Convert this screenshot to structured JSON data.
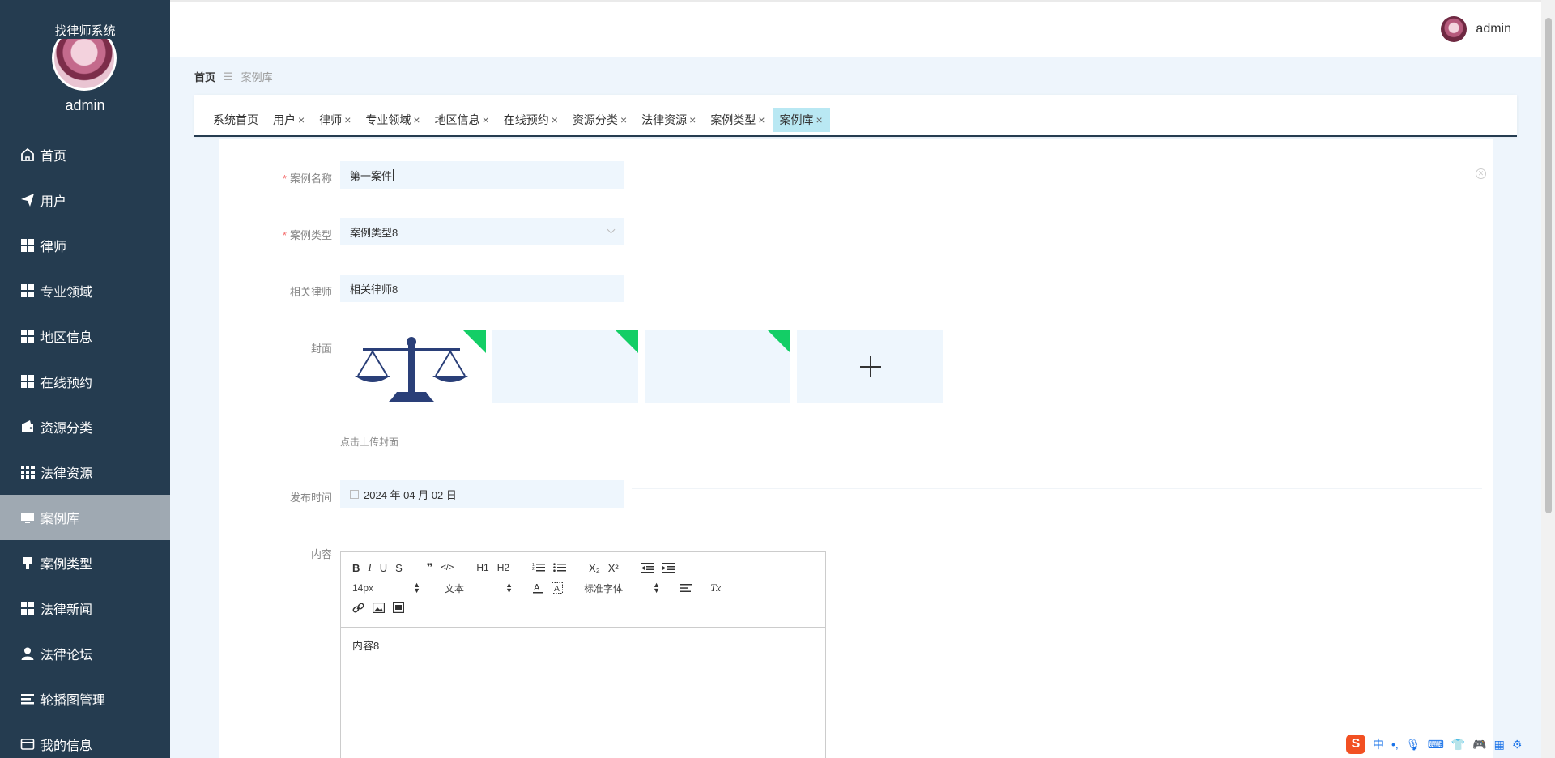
{
  "sidebar": {
    "system_title": "找律师系统",
    "username": "admin",
    "items": [
      {
        "label": "首页",
        "icon": "home-icon",
        "active": false
      },
      {
        "label": "用户",
        "icon": "paper-plane-icon",
        "active": false
      },
      {
        "label": "律师",
        "icon": "grid-icon",
        "active": false
      },
      {
        "label": "专业领域",
        "icon": "grid-icon",
        "active": false
      },
      {
        "label": "地区信息",
        "icon": "grid-icon",
        "active": false
      },
      {
        "label": "在线预约",
        "icon": "grid-icon",
        "active": false
      },
      {
        "label": "资源分类",
        "icon": "wallet-icon",
        "active": false
      },
      {
        "label": "法律资源",
        "icon": "grid9-icon",
        "active": false
      },
      {
        "label": "案例库",
        "icon": "monitor-icon",
        "active": true
      },
      {
        "label": "案例类型",
        "icon": "brush-icon",
        "active": false
      },
      {
        "label": "法律新闻",
        "icon": "grid-icon",
        "active": false
      },
      {
        "label": "法律论坛",
        "icon": "user-icon",
        "active": false
      },
      {
        "label": "轮播图管理",
        "icon": "list-icon",
        "active": false
      },
      {
        "label": "我的信息",
        "icon": "card-icon",
        "active": false
      }
    ]
  },
  "header": {
    "username": "admin"
  },
  "breadcrumb": {
    "home": "首页",
    "separator": "☰",
    "current": "案例库"
  },
  "tabs": [
    {
      "label": "系统首页",
      "closable": false,
      "active": false
    },
    {
      "label": "用户",
      "closable": true,
      "active": false
    },
    {
      "label": "律师",
      "closable": true,
      "active": false
    },
    {
      "label": "专业领域",
      "closable": true,
      "active": false
    },
    {
      "label": "地区信息",
      "closable": true,
      "active": false
    },
    {
      "label": "在线预约",
      "closable": true,
      "active": false
    },
    {
      "label": "资源分类",
      "closable": true,
      "active": false
    },
    {
      "label": "法律资源",
      "closable": true,
      "active": false
    },
    {
      "label": "案例类型",
      "closable": true,
      "active": false
    },
    {
      "label": "案例库",
      "closable": true,
      "active": true
    }
  ],
  "tab_close_glyph": "×",
  "form": {
    "case_name": {
      "label": "案例名称",
      "required": true,
      "value": "第一案件"
    },
    "case_type": {
      "label": "案例类型",
      "required": true,
      "value": "案例类型8"
    },
    "lawyer": {
      "label": "相关律师",
      "value": "相关律师8"
    },
    "cover": {
      "label": "封面",
      "hint": "点击上传封面",
      "uploaded_count": 3
    },
    "publish_time": {
      "label": "发布时间",
      "value": "2024 年 04 月 02 日"
    },
    "content": {
      "label": "内容",
      "value": "内容8"
    }
  },
  "editor_toolbar": {
    "row1": [
      "B",
      "I",
      "U",
      "S",
      "❞",
      "</>",
      "H1",
      "H2",
      "ordered-list",
      "bullet-list",
      "X₂",
      "X²",
      "outdent",
      "indent"
    ],
    "font_size": "14px",
    "block_type": "文本",
    "font_family": "标准字体",
    "clear_format": "Tx"
  },
  "ime": {
    "lang": "中"
  },
  "colors": {
    "sidebar_bg": "#253c50",
    "active_tab": "#b9e8f3",
    "accent_green": "#13ce66",
    "required_star": "#f56c6c"
  }
}
